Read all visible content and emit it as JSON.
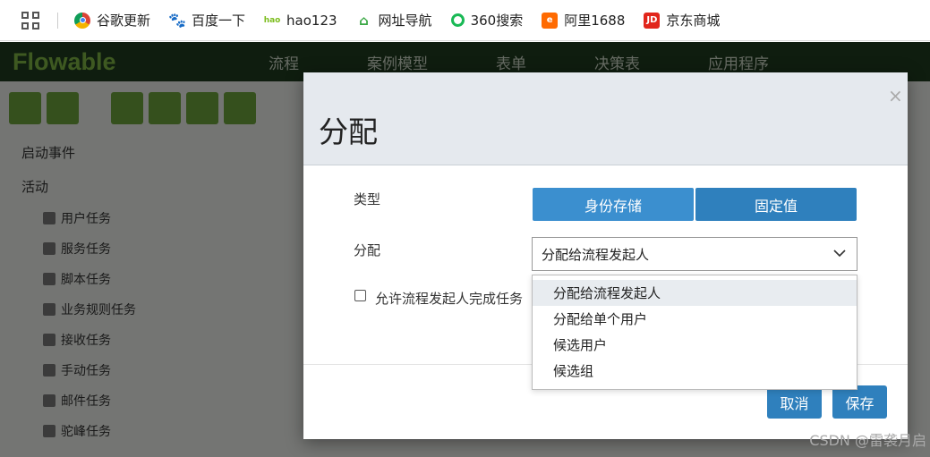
{
  "bookmarks": [
    {
      "label": "谷歌更新",
      "icon": "chrome-icon",
      "color": "#db4437"
    },
    {
      "label": "百度一下",
      "icon": "baidu-paw-icon",
      "color": "#2932e1"
    },
    {
      "label": "hao123",
      "icon": "hao123-icon",
      "color": "#7cbd1e"
    },
    {
      "label": "网址导航",
      "icon": "house-2345-icon",
      "color": "#3aa845"
    },
    {
      "label": "360搜索",
      "icon": "360-search-icon",
      "color": "#19b955"
    },
    {
      "label": "阿里1688",
      "icon": "alibaba-1688-icon",
      "color": "#ff6a00"
    },
    {
      "label": "京东商城",
      "icon": "jd-icon",
      "color": "#e1251b"
    }
  ],
  "app": {
    "logo": "Flowable",
    "nav": [
      "流程",
      "案例模型",
      "表单",
      "决策表",
      "应用程序"
    ],
    "palette": {
      "groups": [
        "启动事件",
        "活动"
      ],
      "items": [
        "用户任务",
        "服务任务",
        "脚本任务",
        "业务规则任务",
        "接收任务",
        "手动任务",
        "邮件任务",
        "驼峰任务"
      ]
    }
  },
  "modal": {
    "title": "分配",
    "close": "×",
    "type_label": "类型",
    "type_options": [
      "身份存储",
      "固定值"
    ],
    "assign_label": "分配",
    "assign_selected": "分配给流程发起人",
    "allow_label": "允许流程发起人完成任务",
    "cancel": "取消",
    "save": "保存"
  },
  "dropdown_options": [
    "分配给流程发起人",
    "分配给单个用户",
    "候选用户",
    "候选组"
  ],
  "watermark": "CSDN @雷袭月启",
  "colors": {
    "primary": "#2f80bd",
    "primary_light": "#3b8fcf",
    "header_bg": "#e5e9ee"
  }
}
